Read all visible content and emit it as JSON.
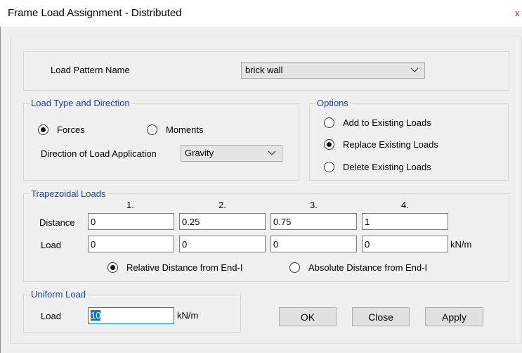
{
  "window": {
    "title": "Frame Load Assignment - Distributed",
    "close_glyph": "x"
  },
  "load_pattern": {
    "label": "Load Pattern Name",
    "value": "brick wall"
  },
  "load_type": {
    "legend": "Load Type and Direction",
    "forces_label": "Forces",
    "moments_label": "Moments",
    "selected": "Forces",
    "direction_label": "Direction of Load Application",
    "direction_value": "Gravity"
  },
  "options": {
    "legend": "Options",
    "add_label": "Add to Existing Loads",
    "replace_label": "Replace Existing Loads",
    "delete_label": "Delete Existing Loads",
    "selected": "Replace Existing Loads"
  },
  "trapezoidal": {
    "legend": "Trapezoidal Loads",
    "columns": [
      "1.",
      "2.",
      "3.",
      "4."
    ],
    "distance_label": "Distance",
    "load_label": "Load",
    "distances": [
      "0",
      "0.25",
      "0.75",
      "1"
    ],
    "loads": [
      "0",
      "0",
      "0",
      "0"
    ],
    "unit": "kN/m",
    "relative_label": "Relative Distance from End-I",
    "absolute_label": "Absolute Distance from End-I",
    "selected": "Relative Distance from End-I"
  },
  "uniform": {
    "legend": "Uniform Load",
    "load_label": "Load",
    "value": "10",
    "unit": "kN/m"
  },
  "buttons": {
    "ok": "OK",
    "close": "Close",
    "apply": "Apply"
  }
}
